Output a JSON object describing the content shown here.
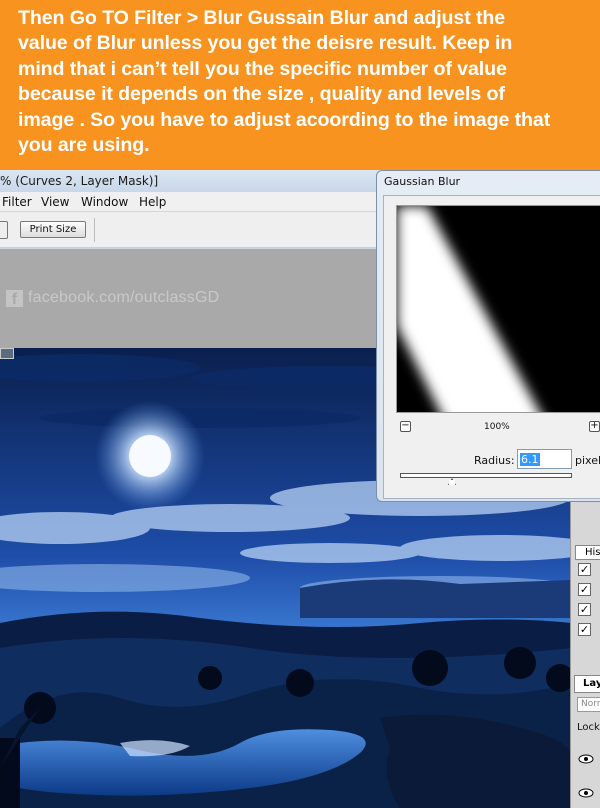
{
  "instruction": {
    "lines": [
      "Then Go TO Filter > Blur Gussain Blur and adjust the",
      "value of Blur unless you get the deisre result. Keep in",
      "mind that i can’t tell you the specific number of value",
      "because it depends on the size , quality and levels of",
      "image . So you have to adjust acoording to the image that",
      "you are using."
    ],
    "background_color": "#f7931e"
  },
  "document": {
    "title": "% (Curves 2, Layer Mask)]",
    "menu": [
      "Filter",
      "View",
      "Window",
      "Help"
    ],
    "print_size_button": "Print Size",
    "watermark": "facebook.com/outclassGD",
    "watermark_badge": "f"
  },
  "dialog": {
    "title": "Gaussian Blur",
    "zoom_label": "100%",
    "zoom_out": "−",
    "zoom_in": "+",
    "radius_label": "Radius:",
    "radius_value": "6.1",
    "unit": "pixels"
  },
  "panels": {
    "histogram_tab": "His",
    "checkmarks": [
      "✓",
      "✓",
      "✓",
      "✓"
    ],
    "layers_tab": "Lay",
    "blend_mode": "Norr",
    "lock_label": "Lock:"
  },
  "icons": [
    "image-icon",
    "facebook-icon",
    "zoom-out-icon",
    "zoom-in-icon",
    "slider-thumb-icon",
    "eye-icon"
  ]
}
